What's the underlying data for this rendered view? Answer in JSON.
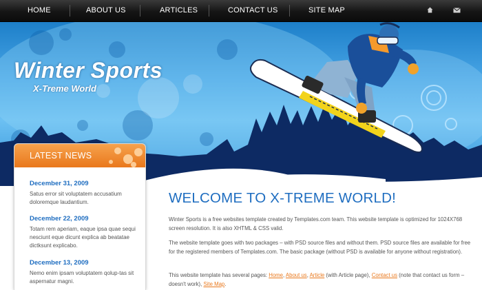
{
  "nav": {
    "items": [
      {
        "label": "HOME"
      },
      {
        "label": "ABOUT US"
      },
      {
        "label": "ARTICLES"
      },
      {
        "label": "CONTACT US"
      },
      {
        "label": "SITE MAP"
      }
    ],
    "icons": [
      "home-icon",
      "mail-icon"
    ]
  },
  "header": {
    "title": "Winter Sports",
    "subtitle": "X-Treme World"
  },
  "sidebar": {
    "title": "LATEST NEWS",
    "news": [
      {
        "date": "December 31, 2009",
        "text": "Satus error sit voluptatem accusatium doloremque laudantium."
      },
      {
        "date": "December 22, 2009",
        "text": "Totam rem aperiam, eaque ipsa quae sequi nesciunt eque dicunt explica ab beatatae dictksunt explicabo."
      },
      {
        "date": "December 13, 2009",
        "text": "Nemo enim ipsam voluptatem qolup-tas sit aspernatur magni."
      }
    ]
  },
  "main": {
    "title": "WELCOME TO X-TREME WORLD!",
    "p1": "Winter Sports is a free websites template created by Templates.com team. This website template is optimized for 1024X768 screen resolution. It is also XHTML & CSS valid.",
    "p2": "The website template goes with two packages – with PSD source files and without them. PSD source files are available for free for the registered members of Templates.com. The basic package (without PSD is available for anyone without registration).",
    "p3": {
      "before": "This website template has several pages: ",
      "link_home": "Home",
      "sep1": ", ",
      "link_about": "About us",
      "sep2": ", ",
      "link_article": "Article",
      "mid": " (with Article page), ",
      "link_contact": "Contact us",
      "after": " (note that contact us form – doesn't work), ",
      "link_sitemap": "Site Map",
      "end": "."
    }
  },
  "colors": {
    "accent_blue": "#1e6dc0",
    "accent_orange": "#e9781c",
    "nav_bg": "#151515",
    "sky": "#49a6e6"
  }
}
